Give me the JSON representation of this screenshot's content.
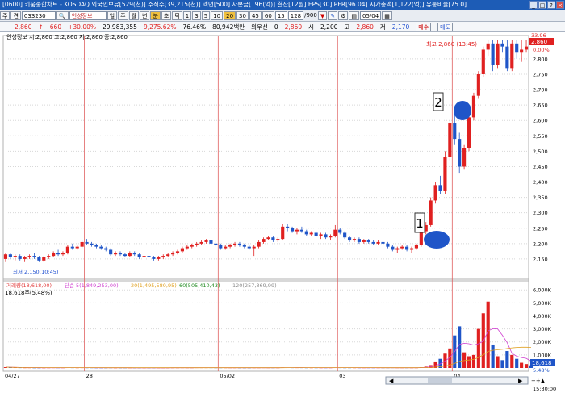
{
  "title_bar": {
    "text": "[0600] 키움종합차트 - KOSDAQ 외국인보유[529(천)] 주식수[39,215(천)] 액면[500] 자본금[196(억)] 결산[12월] EPS[30] PER[96.04] 시가총액[1,122(억)] 유통비율[75.0]"
  },
  "toolbar": {
    "market_selector": "주",
    "period_selector": "견",
    "stock_code": "033230",
    "stock_name": "인성정보",
    "timeframes": [
      "일",
      "주",
      "월",
      "년",
      "분",
      "초",
      "틱"
    ],
    "intervals": [
      "1",
      "3",
      "5",
      "10",
      "20",
      "30",
      "45",
      "60"
    ],
    "selected_interval": "20",
    "minute_input": "15",
    "count": "128",
    "count_total": "/900",
    "date": "05/04"
  },
  "quote": {
    "price": "2,860",
    "change": "660",
    "change_rate": "+30.00%",
    "volume": "29,983,355",
    "volume_ratio": "9,275.62%",
    "volume_power": "76.46%",
    "amount": "80,942백만",
    "investor_label": "외우선",
    "investor_value": "0",
    "current": "2,860",
    "open_label": "시",
    "open": "2,200",
    "high_label": "고",
    "high": "2,860",
    "low_label": "저",
    "low": "2,170",
    "buy_button": "매수",
    "sell_button": "매도"
  },
  "price_panel": {
    "legend": "인성정보 시:2,860 고:2,860 저:2,860 종:2,860",
    "high_annotation": "최고 2,860 (13:45)",
    "low_annotation": "최저 2,150(10:45)",
    "current_price_box": "2,860",
    "top_pct": "33.96",
    "zero_pct": "0.00%"
  },
  "volume_panel": {
    "legend_items": [
      {
        "text": "거래량(18,618,00)",
        "color": "#e23c3c"
      },
      {
        "text": "단순 5(1,849,253,00)",
        "color": "#d040d0"
      },
      {
        "text": "20(1,495,580,95)",
        "color": "#e0a020"
      },
      {
        "text": "60(505,410,43)",
        "color": "#208a20"
      },
      {
        "text": "120(257,869,99)",
        "color": "#8a8a8a"
      }
    ],
    "last_volume": "18,618주(5.48%)",
    "last_volume_box": "18,618",
    "last_pct": "5.48%"
  },
  "markers": [
    {
      "label": "1",
      "color": "#1f55c8"
    },
    {
      "label": "2",
      "color": "#1f55c8"
    }
  ],
  "time_axis": {
    "labels": [
      "04/27",
      "28",
      "05/02",
      "03",
      "04"
    ],
    "clock": "15:30:00"
  },
  "chart_data": {
    "type": "candlestick",
    "title": "인성정보",
    "price_axis": {
      "ylim": [
        2100,
        2860
      ],
      "ticks": [
        2150,
        2200,
        2250,
        2300,
        2350,
        2400,
        2450,
        2500,
        2550,
        2600,
        2650,
        2700,
        2750,
        2800
      ]
    },
    "volume_axis": {
      "unit": "K",
      "ylim": [
        0,
        6200
      ],
      "ticks": [
        1000,
        2000,
        3000,
        4000,
        5000,
        6000
      ]
    },
    "day_separators": [
      "28",
      "05/02",
      "03",
      "04"
    ],
    "candles": [
      [
        2150,
        2170,
        2140,
        2165
      ],
      [
        2165,
        2170,
        2150,
        2155
      ],
      [
        2155,
        2165,
        2145,
        2160
      ],
      [
        2160,
        2165,
        2145,
        2150
      ],
      [
        2150,
        2160,
        2140,
        2155
      ],
      [
        2155,
        2165,
        2150,
        2160
      ],
      [
        2160,
        2170,
        2150,
        2155
      ],
      [
        2155,
        2160,
        2140,
        2145
      ],
      [
        2145,
        2160,
        2140,
        2155
      ],
      [
        2155,
        2165,
        2150,
        2160
      ],
      [
        2160,
        2175,
        2155,
        2170
      ],
      [
        2170,
        2180,
        2160,
        2165
      ],
      [
        2165,
        2175,
        2160,
        2170
      ],
      [
        2170,
        2195,
        2165,
        2190
      ],
      [
        2190,
        2200,
        2180,
        2185
      ],
      [
        2185,
        2195,
        2180,
        2190
      ],
      [
        2190,
        2210,
        2185,
        2205
      ],
      [
        2205,
        2215,
        2195,
        2200
      ],
      [
        2200,
        2205,
        2190,
        2195
      ],
      [
        2195,
        2200,
        2185,
        2190
      ],
      [
        2190,
        2195,
        2180,
        2185
      ],
      [
        2185,
        2190,
        2175,
        2180
      ],
      [
        2180,
        2185,
        2160,
        2165
      ],
      [
        2165,
        2175,
        2160,
        2170
      ],
      [
        2170,
        2175,
        2160,
        2165
      ],
      [
        2165,
        2170,
        2155,
        2160
      ],
      [
        2160,
        2175,
        2155,
        2170
      ],
      [
        2170,
        2175,
        2160,
        2165
      ],
      [
        2165,
        2170,
        2150,
        2155
      ],
      [
        2155,
        2165,
        2150,
        2160
      ],
      [
        2160,
        2165,
        2150,
        2155
      ],
      [
        2155,
        2160,
        2145,
        2150
      ],
      [
        2150,
        2160,
        2145,
        2155
      ],
      [
        2155,
        2165,
        2150,
        2160
      ],
      [
        2160,
        2170,
        2155,
        2165
      ],
      [
        2165,
        2175,
        2160,
        2170
      ],
      [
        2170,
        2180,
        2165,
        2175
      ],
      [
        2175,
        2190,
        2170,
        2185
      ],
      [
        2185,
        2195,
        2180,
        2190
      ],
      [
        2190,
        2200,
        2185,
        2195
      ],
      [
        2195,
        2205,
        2190,
        2200
      ],
      [
        2200,
        2210,
        2195,
        2205
      ],
      [
        2205,
        2215,
        2200,
        2210
      ],
      [
        2210,
        2215,
        2195,
        2200
      ],
      [
        2200,
        2210,
        2190,
        2195
      ],
      [
        2195,
        2200,
        2180,
        2185
      ],
      [
        2185,
        2195,
        2180,
        2190
      ],
      [
        2190,
        2200,
        2185,
        2195
      ],
      [
        2195,
        2205,
        2190,
        2200
      ],
      [
        2200,
        2205,
        2190,
        2195
      ],
      [
        2195,
        2200,
        2185,
        2190
      ],
      [
        2190,
        2195,
        2180,
        2185
      ],
      [
        2185,
        2195,
        2160,
        2190
      ],
      [
        2190,
        2210,
        2185,
        2205
      ],
      [
        2205,
        2220,
        2200,
        2215
      ],
      [
        2215,
        2225,
        2210,
        2220
      ],
      [
        2220,
        2225,
        2205,
        2210
      ],
      [
        2210,
        2220,
        2205,
        2215
      ],
      [
        2215,
        2265,
        2210,
        2255
      ],
      [
        2255,
        2265,
        2240,
        2250
      ],
      [
        2250,
        2255,
        2235,
        2240
      ],
      [
        2240,
        2250,
        2230,
        2245
      ],
      [
        2245,
        2255,
        2235,
        2240
      ],
      [
        2240,
        2245,
        2225,
        2230
      ],
      [
        2230,
        2240,
        2225,
        2235
      ],
      [
        2235,
        2240,
        2220,
        2225
      ],
      [
        2225,
        2235,
        2215,
        2230
      ],
      [
        2230,
        2235,
        2215,
        2220
      ],
      [
        2220,
        2230,
        2210,
        2225
      ],
      [
        2225,
        2260,
        2220,
        2245
      ],
      [
        2245,
        2250,
        2230,
        2235
      ],
      [
        2235,
        2240,
        2215,
        2220
      ],
      [
        2220,
        2225,
        2205,
        2210
      ],
      [
        2210,
        2220,
        2205,
        2215
      ],
      [
        2215,
        2220,
        2200,
        2205
      ],
      [
        2205,
        2215,
        2200,
        2210
      ],
      [
        2210,
        2215,
        2200,
        2205
      ],
      [
        2205,
        2210,
        2195,
        2200
      ],
      [
        2200,
        2210,
        2195,
        2205
      ],
      [
        2205,
        2210,
        2195,
        2200
      ],
      [
        2200,
        2205,
        2185,
        2190
      ],
      [
        2190,
        2195,
        2175,
        2180
      ],
      [
        2180,
        2190,
        2170,
        2185
      ],
      [
        2185,
        2195,
        2180,
        2190
      ],
      [
        2190,
        2195,
        2175,
        2180
      ],
      [
        2180,
        2190,
        2170,
        2185
      ],
      [
        2185,
        2200,
        2180,
        2195
      ],
      [
        2195,
        2250,
        2190,
        2240
      ],
      [
        2240,
        2270,
        2230,
        2260
      ],
      [
        2260,
        2350,
        2255,
        2340
      ],
      [
        2340,
        2400,
        2330,
        2390
      ],
      [
        2390,
        2420,
        2360,
        2370
      ],
      [
        2370,
        2500,
        2360,
        2480
      ],
      [
        2480,
        2600,
        2470,
        2590
      ],
      [
        2590,
        2620,
        2520,
        2540
      ],
      [
        2540,
        2560,
        2430,
        2450
      ],
      [
        2450,
        2520,
        2440,
        2510
      ],
      [
        2510,
        2620,
        2500,
        2610
      ],
      [
        2610,
        2690,
        2600,
        2680
      ],
      [
        2680,
        2760,
        2670,
        2750
      ],
      [
        2750,
        2840,
        2740,
        2830
      ],
      [
        2830,
        2860,
        2810,
        2850
      ],
      [
        2850,
        2860,
        2760,
        2780
      ],
      [
        2780,
        2860,
        2770,
        2850
      ],
      [
        2850,
        2860,
        2820,
        2840
      ],
      [
        2840,
        2860,
        2760,
        2770
      ],
      [
        2770,
        2860,
        2760,
        2850
      ],
      [
        2850,
        2860,
        2800,
        2820
      ],
      [
        2820,
        2860,
        2790,
        2830
      ],
      [
        2830,
        2860,
        2820,
        2840
      ]
    ],
    "volumes_k": [
      60,
      40,
      30,
      25,
      20,
      20,
      15,
      15,
      15,
      20,
      25,
      20,
      20,
      30,
      25,
      20,
      25,
      20,
      20,
      15,
      15,
      15,
      20,
      15,
      15,
      15,
      15,
      15,
      15,
      15,
      15,
      15,
      15,
      15,
      15,
      20,
      20,
      25,
      20,
      20,
      25,
      25,
      25,
      25,
      20,
      20,
      20,
      20,
      20,
      15,
      15,
      15,
      20,
      20,
      25,
      20,
      20,
      20,
      40,
      30,
      25,
      25,
      25,
      20,
      20,
      20,
      20,
      20,
      20,
      30,
      25,
      20,
      20,
      20,
      20,
      20,
      20,
      20,
      20,
      20,
      20,
      25,
      20,
      20,
      20,
      20,
      20,
      60,
      100,
      220,
      500,
      700,
      1100,
      1500,
      2500,
      3200,
      1200,
      900,
      1000,
      3000,
      4200,
      5100,
      1800,
      900,
      600,
      1300,
      1000,
      700,
      400,
      300,
      200
    ]
  }
}
